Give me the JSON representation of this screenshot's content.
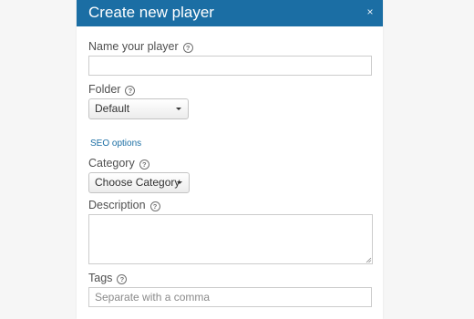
{
  "dialog": {
    "title": "Create new player",
    "close_label": "×"
  },
  "form": {
    "name": {
      "label": "Name your player",
      "value": "",
      "placeholder": ""
    },
    "folder": {
      "label": "Folder",
      "selected": "Default"
    },
    "seo_link": "SEO options",
    "category": {
      "label": "Category",
      "selected": "Choose Category"
    },
    "description": {
      "label": "Description",
      "value": ""
    },
    "tags": {
      "label": "Tags",
      "placeholder": "Separate with a comma"
    },
    "help_glyph": "?"
  },
  "colors": {
    "header": "#1b6ea4",
    "link": "#1b6ea4"
  }
}
